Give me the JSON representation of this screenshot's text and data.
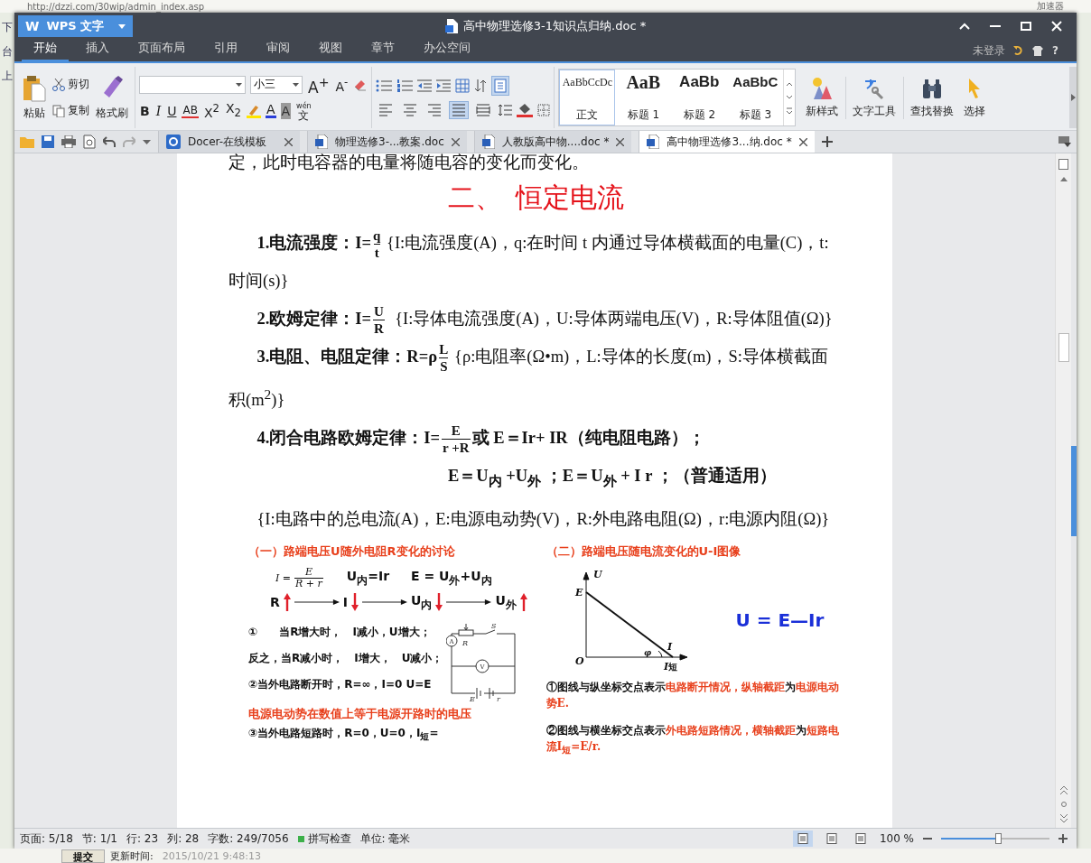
{
  "browser": {
    "url": "http://dzzi.com/30wip/admin_index.asp",
    "top_right": "加速器",
    "left_fragments": [
      "下",
      "台",
      "上"
    ],
    "submit_button": "提交",
    "update_label": "更新时间:",
    "update_time": "2015/10/21 9:48:13"
  },
  "app": {
    "logo": "W",
    "name": "WPS 文字"
  },
  "window": {
    "title": "高中物理选修3-1知识点归纳.doc *"
  },
  "menu_tabs": [
    {
      "label": "开始",
      "selected": true
    },
    {
      "label": "插入",
      "selected": false
    },
    {
      "label": "页面布局",
      "selected": false
    },
    {
      "label": "引用",
      "selected": false
    },
    {
      "label": "审阅",
      "selected": false
    },
    {
      "label": "视图",
      "selected": false
    },
    {
      "label": "章节",
      "selected": false
    },
    {
      "label": "办公空间",
      "selected": false
    }
  ],
  "account": {
    "label": "未登录",
    "help": "?"
  },
  "ribbon": {
    "paste": "粘贴",
    "cut": "剪切",
    "copy": "复制",
    "format_painter": "格式刷",
    "font_size": "小三",
    "grow": "A$^{+}$",
    "shrink": "A$^{-}$",
    "format_buttons": [
      "B",
      "I",
      "U",
      "AB",
      "X$^{2}$",
      "X$_{2}$"
    ],
    "font_color": "A",
    "char_shading": "A",
    "pinyin_top": "wén",
    "pinyin_glyph": "文",
    "align_buttons": [
      {
        "selected": false
      },
      {
        "selected": false
      },
      {
        "selected": false
      },
      {
        "selected": true
      },
      {
        "selected": false
      }
    ],
    "show_marks": {
      "on": true
    },
    "styles": [
      {
        "preview": "AaBbCcDc",
        "label": "正文",
        "selected": true
      },
      {
        "preview": "AaB",
        "label": "标题 1",
        "selected": false
      },
      {
        "preview": "AaBb",
        "label": "标题 2",
        "selected": false
      },
      {
        "preview": "AaBbC",
        "label": "标题 3",
        "selected": false
      }
    ],
    "new_style": "新样式",
    "text_tools": "文字工具",
    "find_replace": "查找替换",
    "select": "选择"
  },
  "doc_tabs": [
    {
      "label": "Docer-在线模板",
      "kind": "docer",
      "selected": false
    },
    {
      "label": "物理选修3-...教案.doc",
      "kind": "doc",
      "selected": false
    },
    {
      "label": "人教版高中物....doc *",
      "kind": "doc",
      "selected": false
    },
    {
      "label": "高中物理选修3...纳.doc *",
      "kind": "doc",
      "selected": true
    }
  ],
  "document": {
    "top_line": "定，此时电容器的电量将随电容的变化而变化。",
    "heading": "二、  恒定电流",
    "blocks": [
      {
        "kind": "para",
        "segments": [
          {
            "kind": "bold",
            "text": "1.电流强度："
          },
          {
            "kind": "bold",
            "text": "I="
          },
          {
            "kind": "frac",
            "num": "q",
            "den": "t"
          },
          {
            "kind": "text",
            "text": " {I:电流强度(A)，q:在时间 t 内通过导体横截面的电量(C)，t:时间(s)}"
          }
        ]
      },
      {
        "kind": "para",
        "segments": [
          {
            "kind": "bold",
            "text": "2.欧姆定律："
          },
          {
            "kind": "bold",
            "text": "I="
          },
          {
            "kind": "frac",
            "num": "U",
            "den": "R"
          },
          {
            "kind": "text",
            "text": "  {I:导体电流强度(A)，U:导体两端电压(V)，R:导体阻值(Ω)}"
          }
        ]
      },
      {
        "kind": "para",
        "segments": [
          {
            "kind": "bold",
            "text": "3.电阻、电阻定律："
          },
          {
            "kind": "bold",
            "text": "R=ρ"
          },
          {
            "kind": "frac",
            "num": "L",
            "den": "S"
          },
          {
            "kind": "text",
            "text": " {ρ:电阻率(Ω•m)，L:导体的长度(m)，S:导体横截面积(m$^{2}$)}"
          }
        ]
      },
      {
        "kind": "para",
        "segments": [
          {
            "kind": "bold",
            "text": "4.闭合电路欧姆定律："
          },
          {
            "kind": "bold",
            "text": "I="
          },
          {
            "kind": "frac",
            "num": "E",
            "den": "r +R"
          },
          {
            "kind": "bold",
            "text": "或 E＝Ir+ IR（纯电阻电路）；"
          }
        ]
      },
      {
        "kind": "formula-line",
        "segments": [
          {
            "kind": "bold",
            "text": "E＝U$_{内}$ +U$_{外}$ ；E＝U$_{外}$ + I r ；（普通适用）"
          }
        ]
      },
      {
        "kind": "para",
        "segments": [
          {
            "kind": "text",
            "text": "{I:电路中的总电流(A)，E:电源电动势(V)，R:外电路电阻(Ω)，r:电源内阻(Ω)}"
          }
        ]
      }
    ],
    "figure": {
      "left_heading": "（一）路端电压U随外电阻R变化的讨论",
      "formula_top": {
        "lhs": "I =",
        "num": "E",
        "den": "R + r",
        "u_inner": "U$_{内}$=Ir",
        "sum": "E = U$_{外}$+U$_{内}$"
      },
      "chain": [
        {
          "text": "R",
          "rising": true
        },
        {
          "text": "I",
          "rising": false
        },
        {
          "text": "U$_{内}$",
          "rising": false
        },
        {
          "text": "U$_{外}$",
          "rising": true
        }
      ],
      "left_lines": [
        "①　　当R增大时，　I减小，U增大；",
        "反之，当R减小时，　I增大，　U减小；",
        "②当外电路断开时，R=∞，I=0 U=E"
      ],
      "circuit_labels": {
        "ammeter": "A",
        "rheostat": "R",
        "switch": "S",
        "voltmeter": "V",
        "emf": "E",
        "internal": "r"
      },
      "red_note": "电源电动势在数值上等于电源开路时的电压",
      "cut_line": "③当外电路短路时，R=0，U=0，I$_{短}$=",
      "right_heading": "（二）路端电压随电流变化的U-I图像",
      "graph_labels": {
        "u_axis": "U",
        "e": "E",
        "origin": "O",
        "i_axis": "I",
        "phi": "φ",
        "i_short": "I",
        "i_short_sub": "短"
      },
      "equation": "U = E—Ir",
      "notes": [
        [
          {
            "text": "①图线与纵坐标交点表示",
            "color": "#111111"
          },
          {
            "text": "电路断开情况，纵轴截距",
            "color": "#e8401c"
          },
          {
            "text": "为",
            "color": "#111111"
          },
          {
            "text": "电源电动势E.",
            "color": "#e8401c"
          }
        ],
        [
          {
            "text": "②图线与横坐标交点表示",
            "color": "#111111"
          },
          {
            "text": "外电路短路情况，横轴截距",
            "color": "#e8401c"
          },
          {
            "text": "为",
            "color": "#111111"
          },
          {
            "text": "短路电流I$_{短}$=E/r.",
            "color": "#e8401c"
          }
        ]
      ]
    }
  },
  "status_bar": {
    "items": [
      "页面: 5/18",
      "节: 1/1",
      "行: 23",
      "列: 28",
      "字数: 249/7056"
    ],
    "spell_check": {
      "label": "拼写检查",
      "on": true
    },
    "unit": "单位: 毫米",
    "views": [
      {
        "selected": true
      },
      {
        "selected": false
      },
      {
        "selected": false
      }
    ],
    "zoom": {
      "label": "100 %",
      "level": 0.5
    }
  }
}
